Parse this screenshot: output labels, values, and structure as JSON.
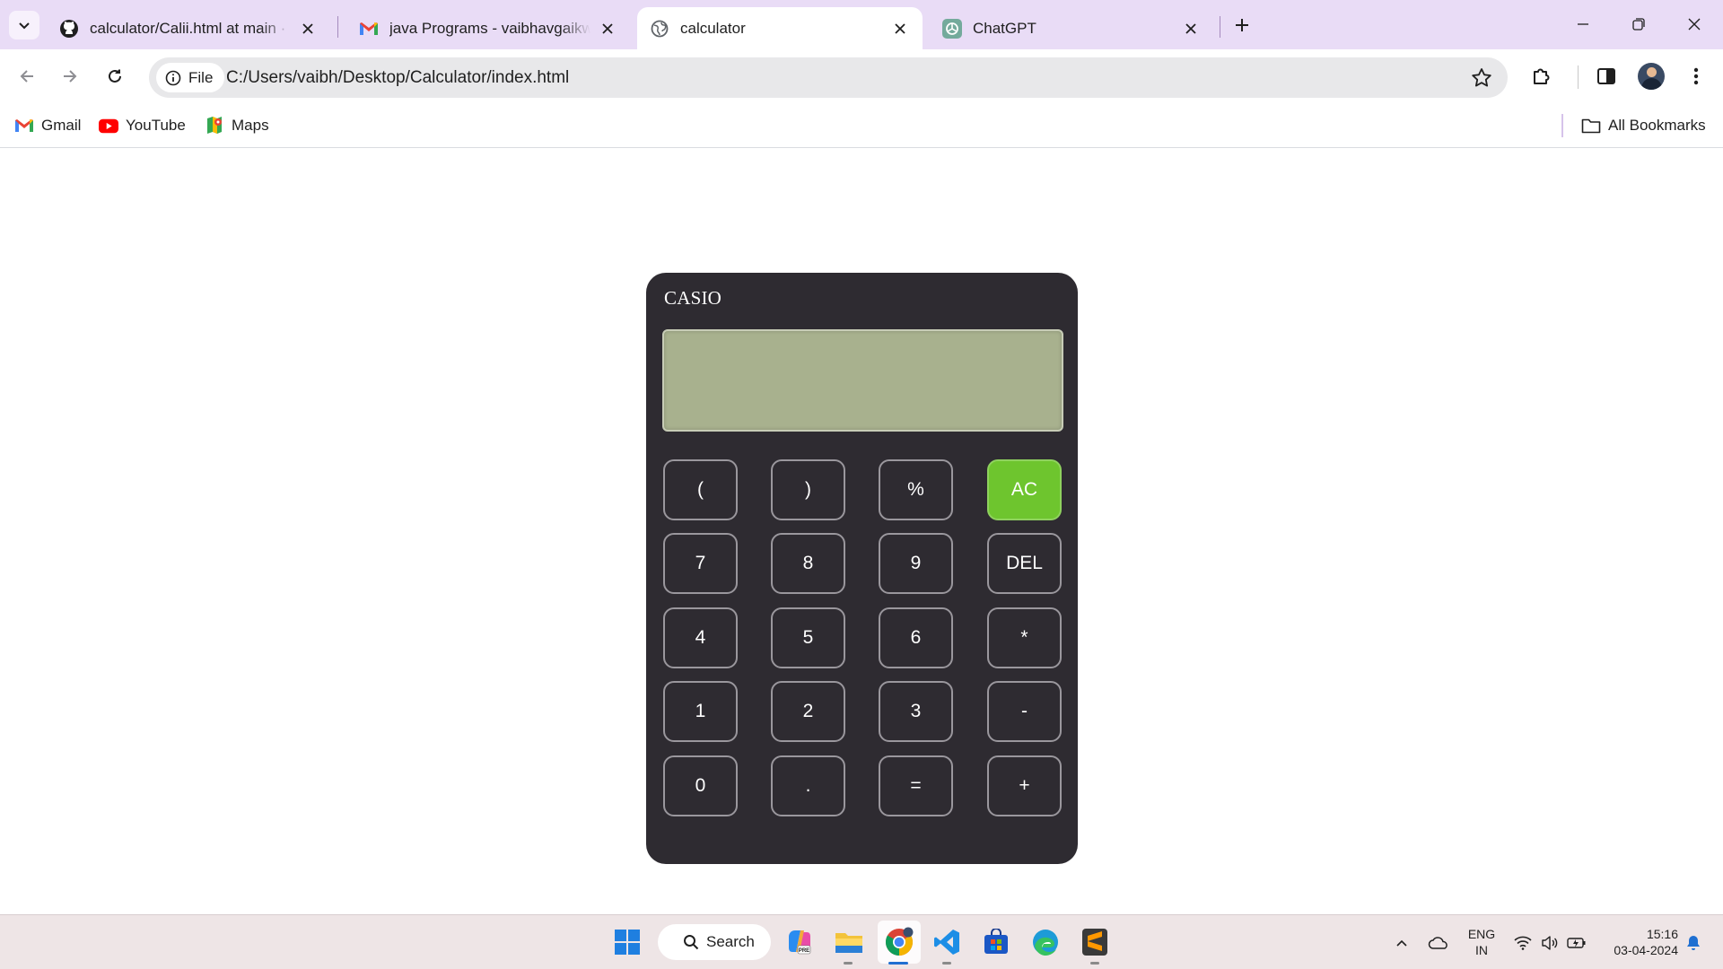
{
  "browser": {
    "tabs": [
      {
        "title": "calculator/Calii.html at main · ra",
        "favicon": "github-icon",
        "active": false
      },
      {
        "title": "java Programs - vaibhavgaikwad",
        "favicon": "gmail-icon",
        "active": false
      },
      {
        "title": "calculator",
        "favicon": "globe-icon",
        "active": true
      },
      {
        "title": "ChatGPT",
        "favicon": "chatgpt-icon",
        "active": false
      }
    ],
    "address": {
      "chip_label": "File",
      "url": "C:/Users/vaibh/Desktop/Calculator/index.html"
    },
    "bookmarks": [
      {
        "label": "Gmail",
        "icon": "gmail-icon"
      },
      {
        "label": "YouTube",
        "icon": "youtube-icon"
      },
      {
        "label": "Maps",
        "icon": "maps-icon"
      }
    ],
    "all_bookmarks_label": "All Bookmarks"
  },
  "calculator": {
    "brand": "CASIO",
    "display_value": "",
    "keys": [
      [
        "(",
        ")",
        "%",
        "AC"
      ],
      [
        "7",
        "8",
        "9",
        "DEL"
      ],
      [
        "4",
        "5",
        "6",
        "*"
      ],
      [
        "1",
        "2",
        "3",
        "-"
      ],
      [
        "0",
        ".",
        "=",
        "+"
      ]
    ],
    "colors": {
      "body": "#2e2b31",
      "screen": "#a8b18e",
      "ac_key": "#6ec52e"
    }
  },
  "taskbar": {
    "search_label": "Search",
    "language": {
      "line1": "ENG",
      "line2": "IN"
    },
    "clock": {
      "time": "15:16",
      "date": "03-04-2024"
    }
  }
}
